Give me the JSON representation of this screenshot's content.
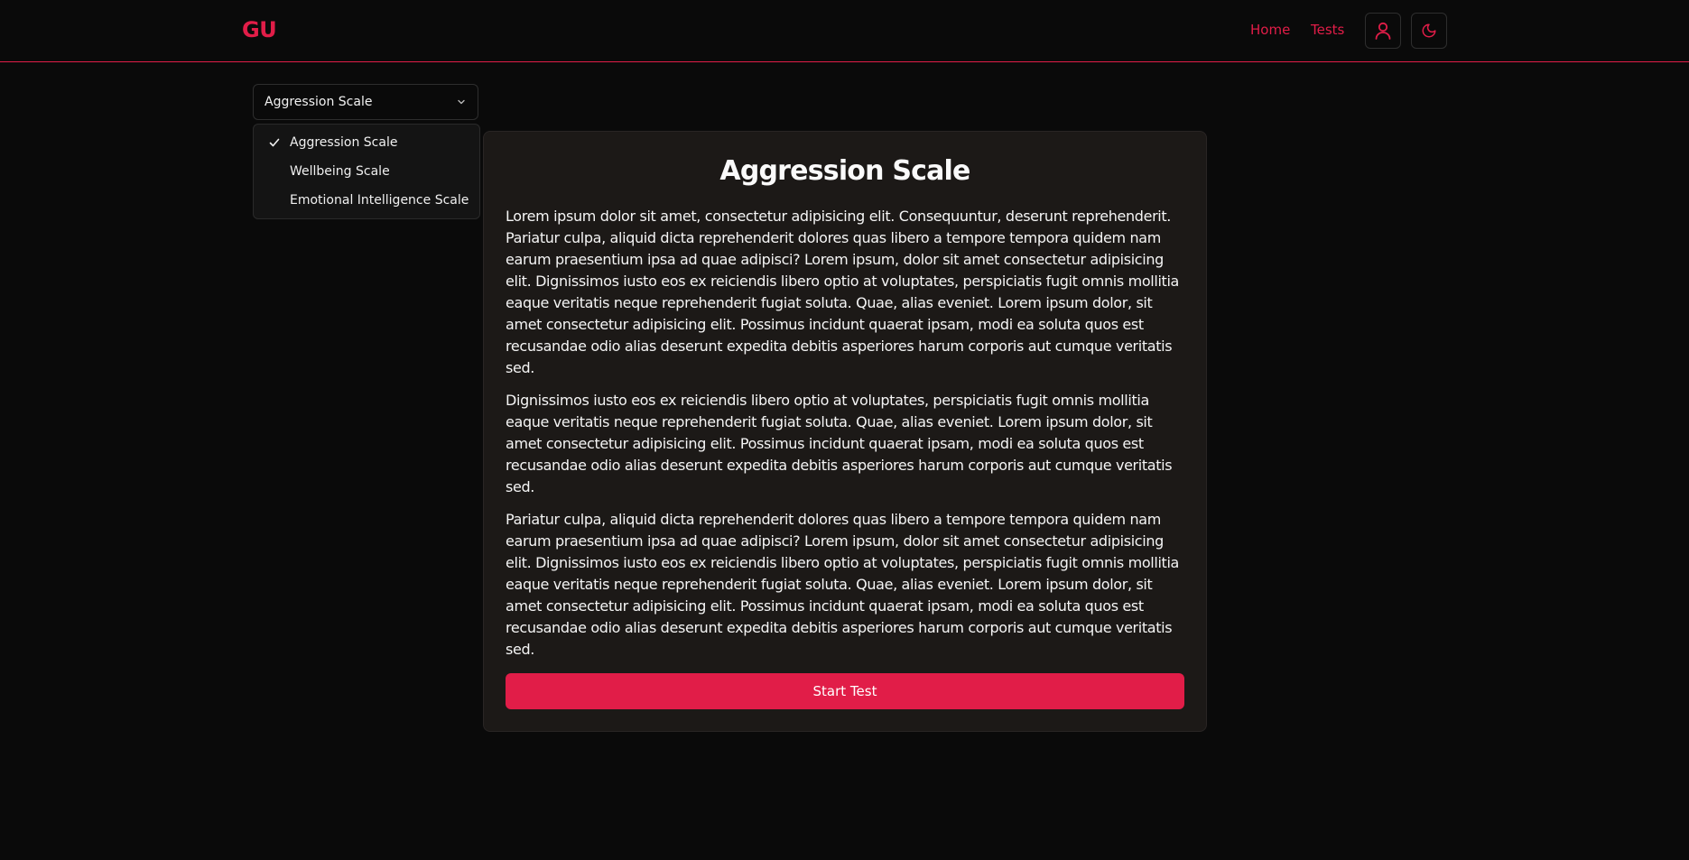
{
  "header": {
    "logo": "GU",
    "nav": {
      "home": "Home",
      "tests": "Tests"
    },
    "icons": {
      "profile": "user-icon",
      "theme": "moon-icon"
    },
    "accent_color": "#e11d48"
  },
  "select": {
    "selected": "Aggression Scale",
    "options": [
      {
        "label": "Aggression Scale",
        "checked": true
      },
      {
        "label": "Wellbeing Scale",
        "checked": false
      },
      {
        "label": "Emotional Intelligence Scale",
        "checked": false
      }
    ]
  },
  "card": {
    "title": "Aggression Scale",
    "paragraphs": [
      "Lorem ipsum dolor sit amet, consectetur adipisicing elit. Consequuntur, deserunt reprehenderit. Pariatur culpa, aliquid dicta reprehenderit dolores quas libero a tempore tempora quidem nam earum praesentium ipsa ad quae adipisci? Lorem ipsum, dolor sit amet consectetur adipisicing elit. Dignissimos iusto eos ex reiciendis libero optio at voluptates, perspiciatis fugit omnis mollitia eaque veritatis neque reprehenderit fugiat soluta. Quae, alias eveniet. Lorem ipsum dolor, sit amet consectetur adipisicing elit. Possimus incidunt quaerat ipsam, modi ea soluta quos est recusandae odio alias deserunt expedita debitis asperiores harum corporis aut cumque veritatis sed.",
      "Dignissimos iusto eos ex reiciendis libero optio at voluptates, perspiciatis fugit omnis mollitia eaque veritatis neque reprehenderit fugiat soluta. Quae, alias eveniet. Lorem ipsum dolor, sit amet consectetur adipisicing elit. Possimus incidunt quaerat ipsam, modi ea soluta quos est recusandae odio alias deserunt expedita debitis asperiores harum corporis aut cumque veritatis sed.",
      "Pariatur culpa, aliquid dicta reprehenderit dolores quas libero a tempore tempora quidem nam earum praesentium ipsa ad quae adipisci? Lorem ipsum, dolor sit amet consectetur adipisicing elit. Dignissimos iusto eos ex reiciendis libero optio at voluptates, perspiciatis fugit omnis mollitia eaque veritatis neque reprehenderit fugiat soluta. Quae, alias eveniet. Lorem ipsum dolor, sit amet consectetur adipisicing elit. Possimus incidunt quaerat ipsam, modi ea soluta quos est recusandae odio alias deserunt expedita debitis asperiores harum corporis aut cumque veritatis sed."
    ],
    "button": "Start Test"
  }
}
